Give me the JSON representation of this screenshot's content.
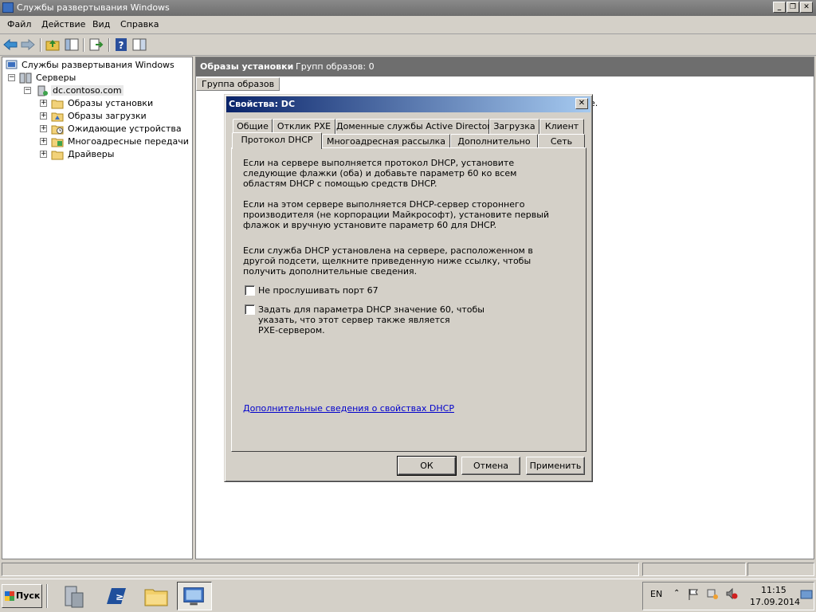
{
  "window": {
    "title": "Службы развертывания Windows"
  },
  "menu": [
    "Файл",
    "Действие",
    "Вид",
    "Справка"
  ],
  "tree": {
    "root": "Службы развертывания Windows",
    "servers": "Серверы",
    "server": "dc.contoso.com",
    "children": [
      "Образы установки",
      "Образы загрузки",
      "Ожидающие устройства",
      "Многоадресные передачи",
      "Драйверы"
    ]
  },
  "rightpane": {
    "header_title": "Образы установки",
    "header_count": "Групп образов: 0",
    "column": "Группа образов",
    "partial_text": "е."
  },
  "dialog": {
    "title": "Свойства: DC",
    "tabs_row1": [
      "Общие",
      "Отклик PXE",
      "Доменные службы Active Directory",
      "Загрузка",
      "Клиент"
    ],
    "tabs_row2": [
      "Протокол DHCP",
      "Многоадресная рассылка",
      "Дополнительно",
      "Сеть"
    ],
    "active_tab": "Протокол DHCP",
    "para1": "Если на сервере выполняется протокол DHCP, установите следующие флажки (оба) и добавьте параметр 60 ко всем областям DHCP с помощью средств DHCP.",
    "para2": "Если на этом сервере выполняется DHCP-сервер стороннего производителя (не корпорации Майкрософт), установите первый флажок и вручную установите параметр 60 для DHCP.",
    "para3": "Если служба DHCP установлена на сервере, расположенном в другой подсети, щелкните приведенную ниже ссылку, чтобы получить дополнительные сведения.",
    "checkbox1": "Не прослушивать порт 67",
    "checkbox2_line1": "Задать для параметра DHCP значение 60, чтобы",
    "checkbox2_line2": "указать, что этот сервер также является",
    "checkbox2_line3": "PXE-сервером.",
    "checkbox1_checked": false,
    "checkbox2_checked": false,
    "link": "Дополнительные сведения о свойствах DHCP",
    "buttons": {
      "ok": "ОК",
      "cancel": "Отмена",
      "apply": "Применить"
    }
  },
  "taskbar": {
    "start": "Пуск",
    "lang": "EN",
    "time": "11:15",
    "date": "17.09.2014"
  },
  "colors": {
    "dialog_title_start": "#0a246a",
    "dialog_title_end": "#a6caf0",
    "link": "#0000cc"
  }
}
